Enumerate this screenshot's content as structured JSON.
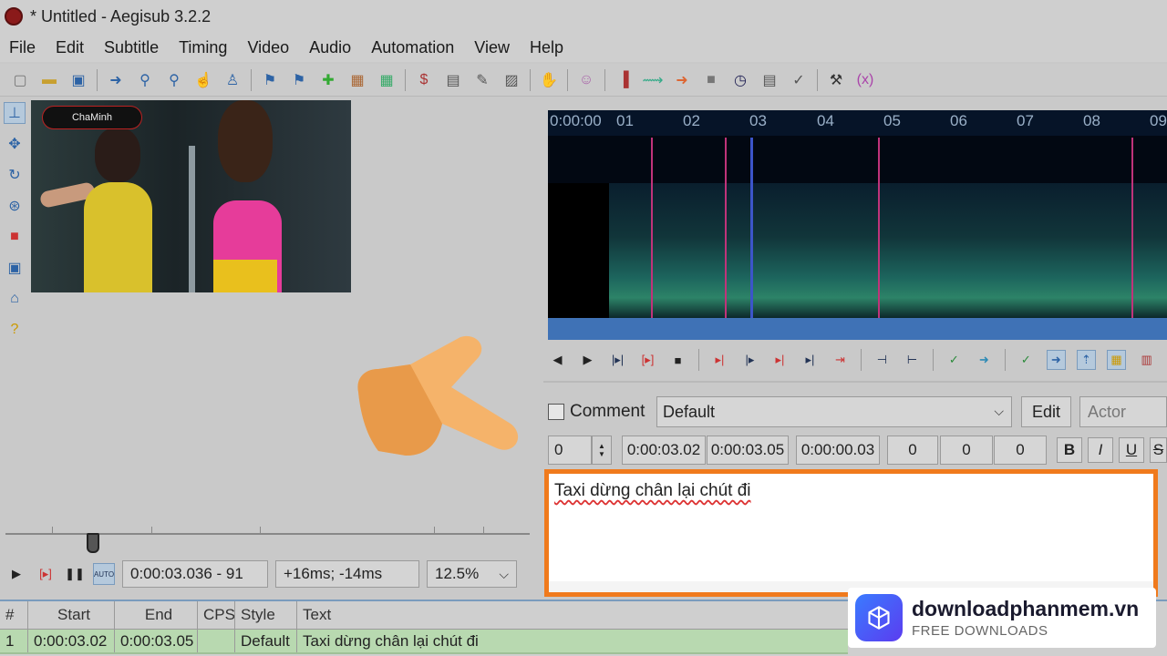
{
  "window": {
    "title": "* Untitled - Aegisub 3.2.2"
  },
  "menu": [
    "File",
    "Edit",
    "Subtitle",
    "Timing",
    "Video",
    "Audio",
    "Automation",
    "View",
    "Help"
  ],
  "toolbar_icons": [
    "new-file-icon",
    "open-file-icon",
    "save-icon",
    "jump-icon",
    "zoom-icon",
    "find-icon",
    "select-icon",
    "properties-icon",
    "styles-icon",
    "attachments-icon",
    "fonts-icon",
    "resample-icon",
    "translate-icon",
    "spell-icon",
    "automation-icon",
    "shift-times-icon",
    "timing-icon",
    "kanji-icon",
    "postprocess-icon",
    "check-icon",
    "options-icon",
    "hotkeys-icon"
  ],
  "video": {
    "logo_text": "ChaMinh",
    "position_label": "0:00:03.036 - 91",
    "offset_label": "+16ms; -14ms",
    "zoom": "12.5%"
  },
  "audio": {
    "time_labels": [
      "0:00:00",
      "01",
      "02",
      "03",
      "04",
      "05",
      "06",
      "07",
      "08",
      "09"
    ]
  },
  "edit": {
    "comment_label": "Comment",
    "style": "Default",
    "edit_button": "Edit",
    "actor_placeholder": "Actor",
    "layer": "0",
    "start": "0:00:03.02",
    "end": "0:00:03.05",
    "duration": "0:00:00.03",
    "margin_l": "0",
    "margin_r": "0",
    "margin_v": "0",
    "bold": "B",
    "italic": "I",
    "underline": "U",
    "strike": "S",
    "text": "Taxi dừng chân lại chút đi"
  },
  "grid": {
    "headers": [
      "#",
      "Start",
      "End",
      "CPS",
      "Style",
      "Text"
    ],
    "rows": [
      {
        "num": "1",
        "start": "0:00:03.02",
        "end": "0:00:03.05",
        "cps": "",
        "style": "Default",
        "text": "Taxi dừng chân lại chút đi"
      }
    ]
  },
  "watermark": {
    "title": "downloadphanmem.vn",
    "subtitle": "FREE DOWNLOADS"
  },
  "colors": {
    "highlight_border": "#f07a1c",
    "grid_row": "#b8d9b0",
    "audio_bottom": "#3f72b6"
  }
}
